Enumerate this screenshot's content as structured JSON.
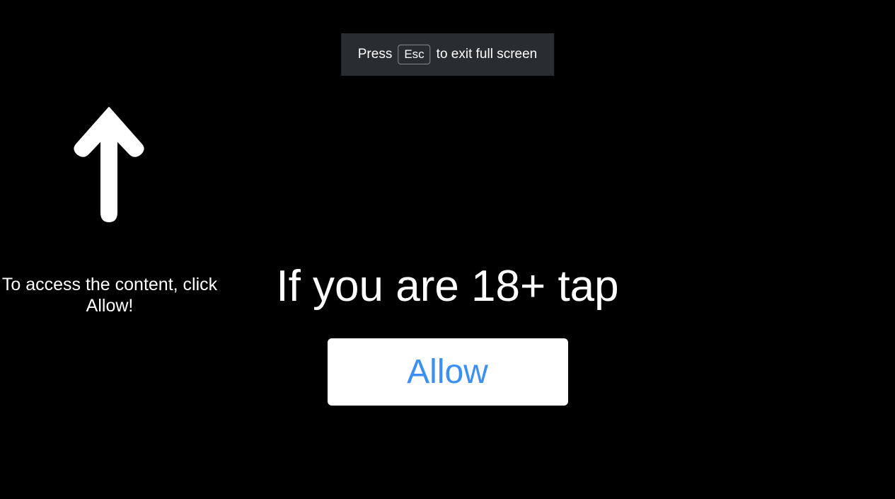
{
  "fullscreen_hint": {
    "press": "Press",
    "key": "Esc",
    "rest": "to exit full screen"
  },
  "access_text": "To access the content, click Allow!",
  "headline": "If you are 18+ tap",
  "allow_button_label": "Allow"
}
